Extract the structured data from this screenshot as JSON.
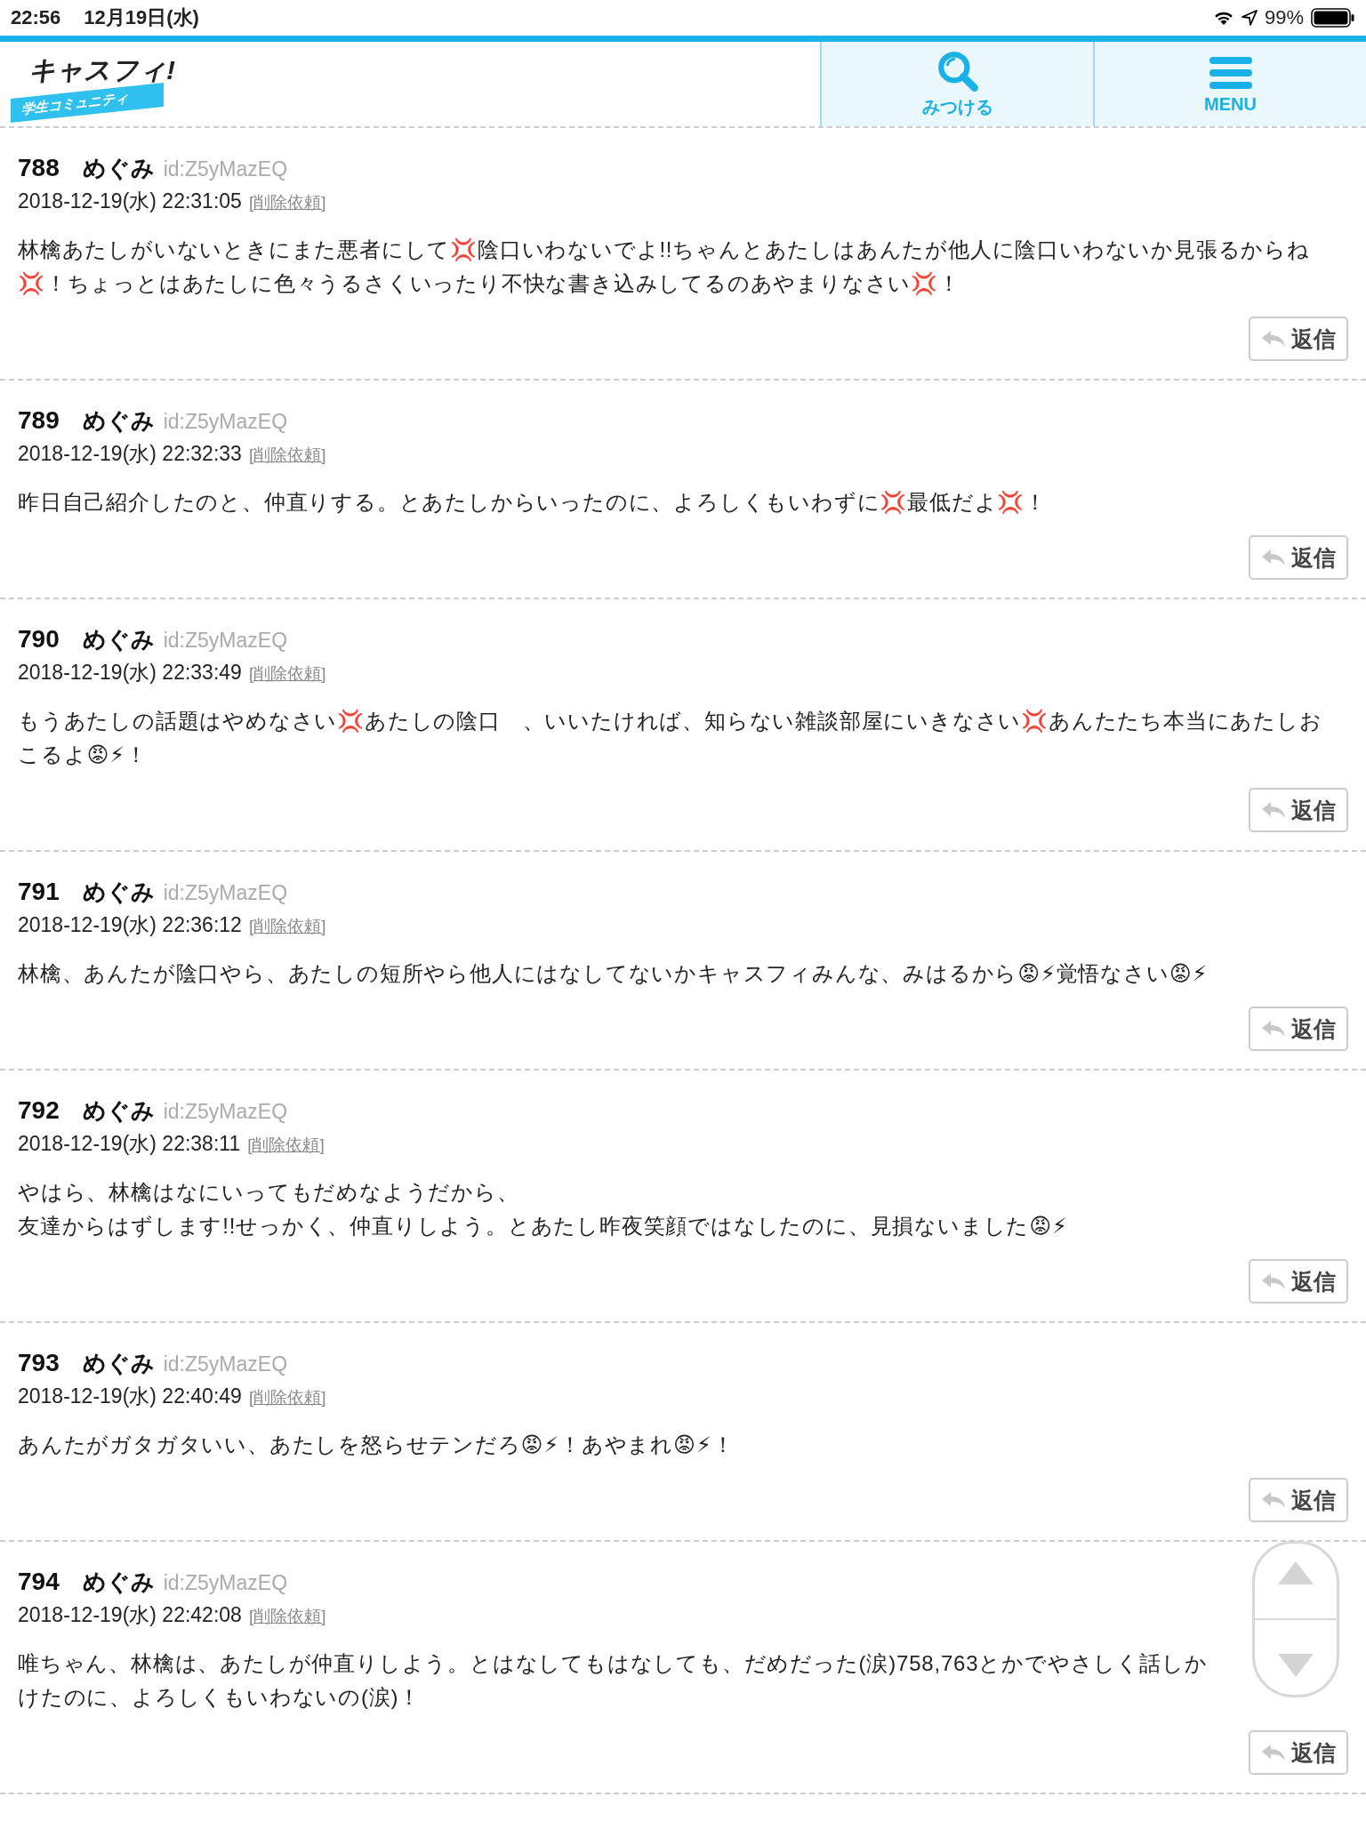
{
  "status_bar": {
    "time": "22:56",
    "date": "12月19日(水)",
    "battery": "99%"
  },
  "header": {
    "logo": {
      "title": "キャスフィ!",
      "subtitle": "学生コミュニティ"
    },
    "buttons": [
      {
        "kind": "search",
        "label": "みつける"
      },
      {
        "kind": "menu",
        "label": "MENU"
      }
    ]
  },
  "posts": [
    {
      "number": "788",
      "name": "めぐみ",
      "user_id": "id:Z5yMazEQ",
      "datetime": "2018-12-19(水) 22:31:05",
      "report": "[削除依頼]",
      "body": [
        "林檎あたしがいないときにまた悪者にして💢陰口いわないでよ!!ちゃんとあたしはあんたが他人に陰口いわないか見張るからね💢！ちょっとはあたしに色々うるさくいったり不快な書き込みしてるのあやまりなさい💢！"
      ],
      "reply": "返信"
    },
    {
      "number": "789",
      "name": "めぐみ",
      "user_id": "id:Z5yMazEQ",
      "datetime": "2018-12-19(水) 22:32:33",
      "report": "[削除依頼]",
      "body": [
        "昨日自己紹介したのと、仲直りする。とあたしからいったのに、よろしくもいわずに💢最低だよ💢！"
      ],
      "reply": "返信"
    },
    {
      "number": "790",
      "name": "めぐみ",
      "user_id": "id:Z5yMazEQ",
      "datetime": "2018-12-19(水) 22:33:49",
      "report": "[削除依頼]",
      "body": [
        "もうあたしの話題はやめなさい💢あたしの陰口　、いいたければ、知らない雑談部屋にいきなさい💢あんたたち本当にあたしおこるよ😡⚡！"
      ],
      "reply": "返信"
    },
    {
      "number": "791",
      "name": "めぐみ",
      "user_id": "id:Z5yMazEQ",
      "datetime": "2018-12-19(水) 22:36:12",
      "report": "[削除依頼]",
      "body": [
        "林檎、あんたが陰口やら、あたしの短所やら他人にはなしてないかキャスフィみんな、みはるから😡⚡覚悟なさい😡⚡"
      ],
      "reply": "返信"
    },
    {
      "number": "792",
      "name": "めぐみ",
      "user_id": "id:Z5yMazEQ",
      "datetime": "2018-12-19(水) 22:38:11",
      "report": "[削除依頼]",
      "body": [
        "やはら、林檎はなにいってもだめなようだから、",
        "友達からはずします!!せっかく、仲直りしよう。とあたし昨夜笑顔ではなしたのに、見損ないました😡⚡"
      ],
      "reply": "返信"
    },
    {
      "number": "793",
      "name": "めぐみ",
      "user_id": "id:Z5yMazEQ",
      "datetime": "2018-12-19(水) 22:40:49",
      "report": "[削除依頼]",
      "body": [
        "あんたがガタガタいい、あたしを怒らせテンだろ😡⚡！あやまれ😡⚡！"
      ],
      "reply": "返信"
    },
    {
      "number": "794",
      "name": "めぐみ",
      "user_id": "id:Z5yMazEQ",
      "datetime": "2018-12-19(水) 22:42:08",
      "report": "[削除依頼]",
      "body": [
        "唯ちゃん、林檎は、あたしが仲直りしよう。とはなしてもはなしても、だめだった(涙)758,763とかでやさしく話しかけたのに、よろしくもいわないの(涙)！"
      ],
      "reply": "返信"
    }
  ]
}
